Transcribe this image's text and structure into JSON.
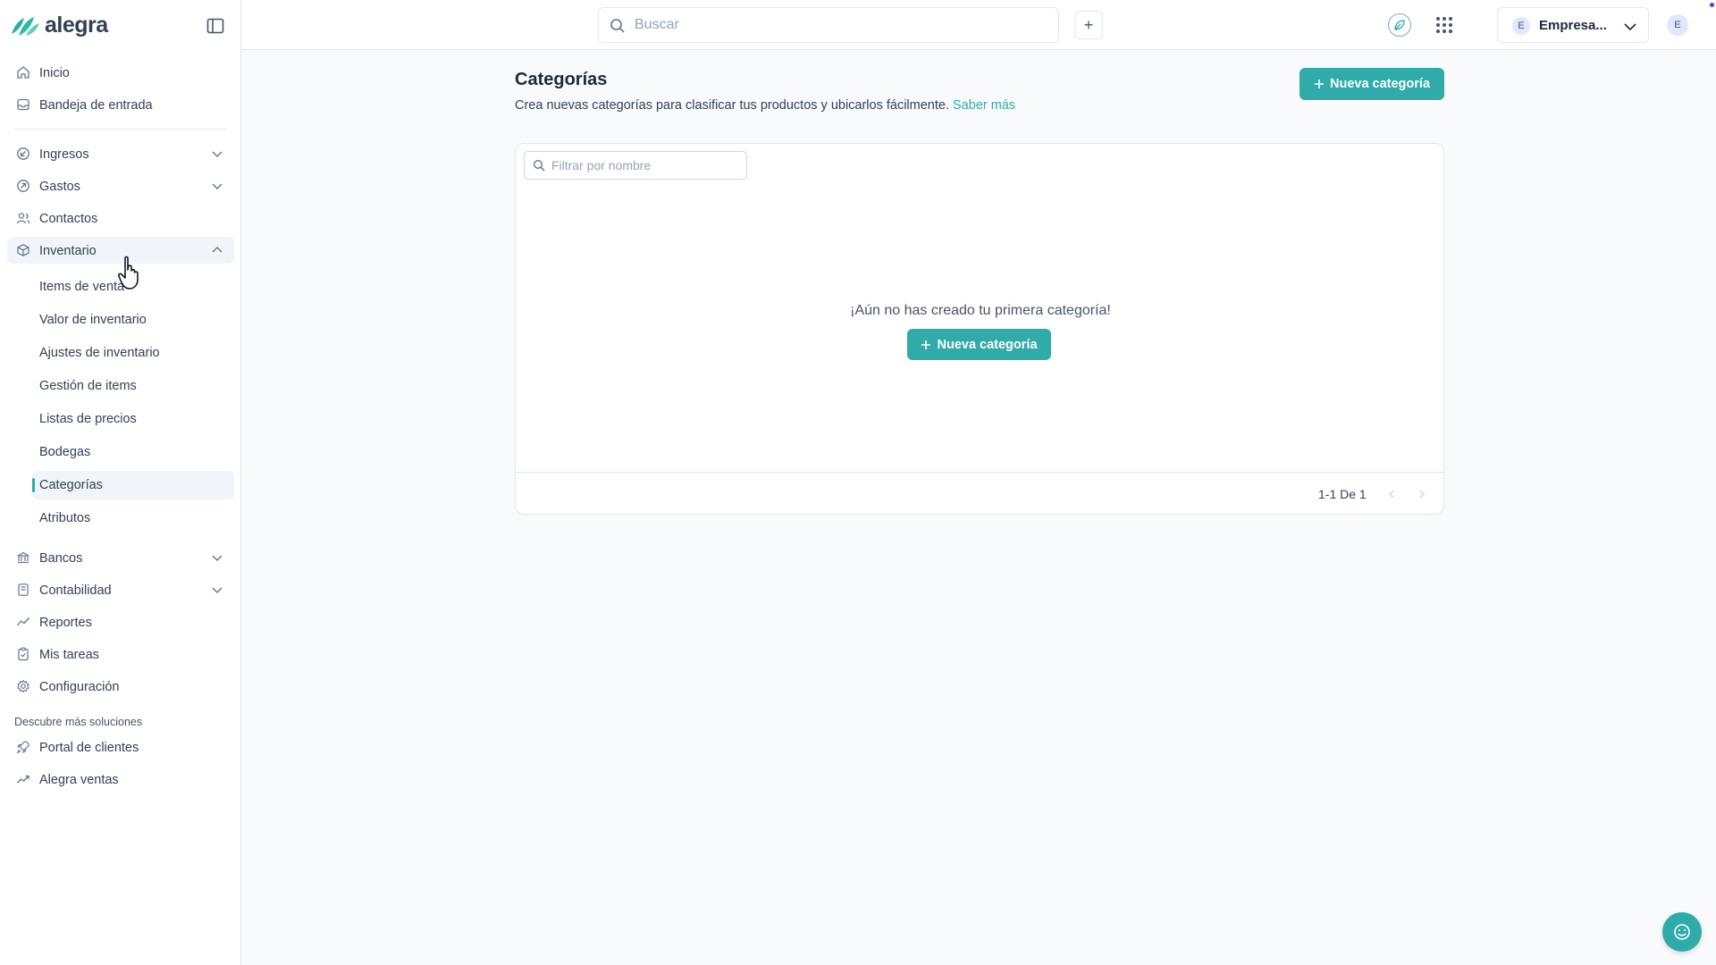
{
  "brand": {
    "name": "alegra",
    "accent": "#30aba9"
  },
  "topbar": {
    "search_placeholder": "Buscar",
    "add_label": "+",
    "company_name": "Empresa...",
    "company_initial": "E",
    "user_initial": "E"
  },
  "sidebar": {
    "top_items": [
      {
        "label": "Inicio",
        "icon": "home-icon"
      },
      {
        "label": "Bandeja de entrada",
        "icon": "inbox-icon"
      }
    ],
    "items": [
      {
        "label": "Ingresos",
        "icon": "income-icon",
        "expandable": true
      },
      {
        "label": "Gastos",
        "icon": "expense-icon",
        "expandable": true
      },
      {
        "label": "Contactos",
        "icon": "contacts-icon",
        "expandable": false
      },
      {
        "label": "Inventario",
        "icon": "box-icon",
        "expandable": true,
        "expanded": true
      }
    ],
    "inventory_sub": [
      "Items de venta",
      "Valor de inventario",
      "Ajustes de inventario",
      "Gestión de items",
      "Listas de precios",
      "Bodegas",
      "Categorías",
      "Atributos"
    ],
    "active_sub": "Categorías",
    "bottom_items": [
      {
        "label": "Bancos",
        "icon": "bank-icon",
        "expandable": true
      },
      {
        "label": "Contabilidad",
        "icon": "accounting-icon",
        "expandable": true
      },
      {
        "label": "Reportes",
        "icon": "reports-icon",
        "expandable": false
      },
      {
        "label": "Mis tareas",
        "icon": "tasks-icon",
        "expandable": false
      },
      {
        "label": "Configuración",
        "icon": "gear-icon",
        "expandable": false
      }
    ],
    "solutions_title": "Descubre más soluciones",
    "solutions": [
      {
        "label": "Portal de clientes",
        "icon": "rocket-icon"
      },
      {
        "label": "Alegra ventas",
        "icon": "trend-icon"
      }
    ]
  },
  "main": {
    "title": "Categorías",
    "description": "Crea nuevas categorías para clasificar tus productos y ubicarlos fácilmente.",
    "learn_more": "Saber más",
    "new_button": "Nueva categoría",
    "filter_placeholder": "Filtrar por nombre",
    "empty_message": "¡Aún no has creado tu primera categoría!",
    "pagination": "1-1 De 1"
  }
}
